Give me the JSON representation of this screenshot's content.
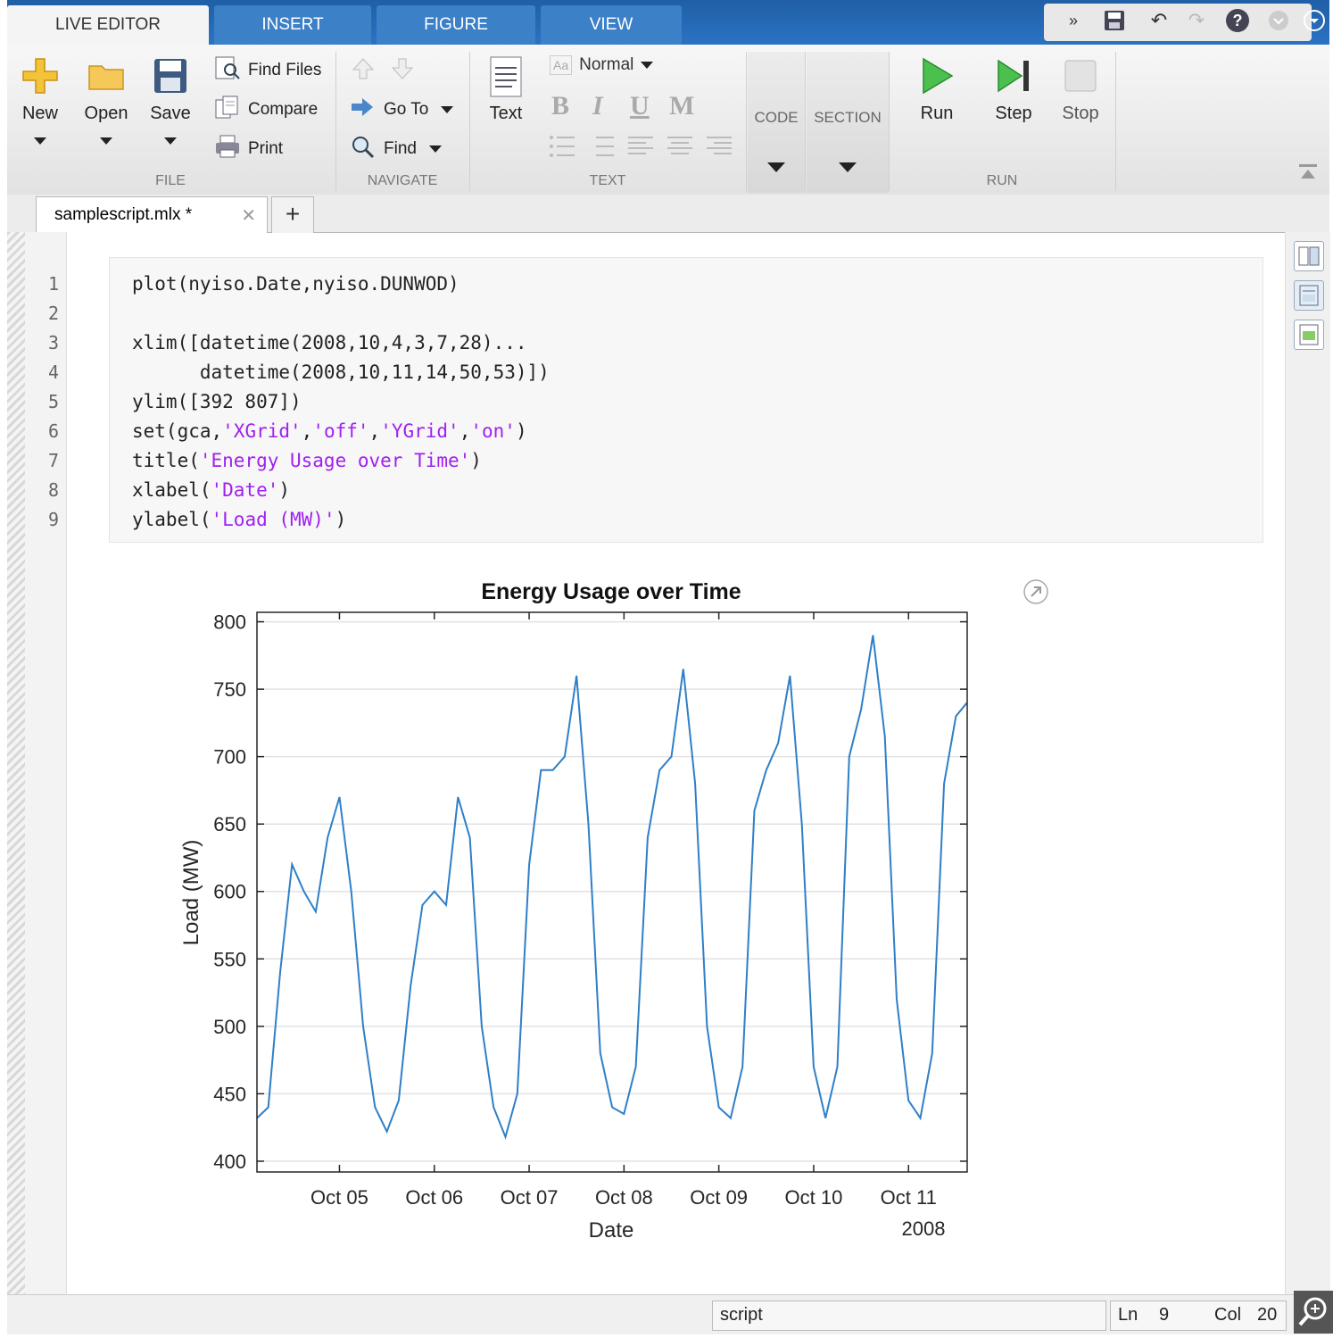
{
  "ribbon_tabs": [
    "LIVE EDITOR",
    "INSERT",
    "FIGURE",
    "VIEW"
  ],
  "file_section": {
    "label": "FILE",
    "new": "New",
    "open": "Open",
    "save": "Save",
    "find_files": "Find Files",
    "compare": "Compare",
    "print": "Print"
  },
  "navigate_section": {
    "label": "NAVIGATE",
    "go_to": "Go To",
    "find": "Find"
  },
  "text_section": {
    "label": "TEXT",
    "text": "Text",
    "style": "Normal",
    "style_icon": "Aa",
    "bold": "B",
    "italic": "I",
    "underline": "U",
    "mono": "M"
  },
  "code_section": {
    "label": "CODE"
  },
  "section_section": {
    "label": "SECTION"
  },
  "run_section": {
    "label": "RUN",
    "run": "Run",
    "step": "Step",
    "stop": "Stop"
  },
  "document_tab": {
    "name": "samplescript.mlx *",
    "add": "+"
  },
  "code_lines": [
    {
      "n": "1",
      "parts": [
        {
          "t": "plot(nyiso.Date,nyiso.DUNWOD)",
          "s": false
        }
      ]
    },
    {
      "n": "2",
      "parts": []
    },
    {
      "n": "3",
      "parts": [
        {
          "t": "xlim([datetime(2008,10,4,3,7,28)...",
          "s": false
        }
      ]
    },
    {
      "n": "4",
      "parts": [
        {
          "t": "      datetime(2008,10,11,14,50,53)])",
          "s": false
        }
      ]
    },
    {
      "n": "5",
      "parts": [
        {
          "t": "ylim([392 807])",
          "s": false
        }
      ]
    },
    {
      "n": "6",
      "parts": [
        {
          "t": "set(gca,",
          "s": false
        },
        {
          "t": "'XGrid'",
          "s": true
        },
        {
          "t": ",",
          "s": false
        },
        {
          "t": "'off'",
          "s": true
        },
        {
          "t": ",",
          "s": false
        },
        {
          "t": "'YGrid'",
          "s": true
        },
        {
          "t": ",",
          "s": false
        },
        {
          "t": "'on'",
          "s": true
        },
        {
          "t": ")",
          "s": false
        }
      ]
    },
    {
      "n": "7",
      "parts": [
        {
          "t": "title(",
          "s": false
        },
        {
          "t": "'Energy Usage over Time'",
          "s": true
        },
        {
          "t": ")",
          "s": false
        }
      ]
    },
    {
      "n": "8",
      "parts": [
        {
          "t": "xlabel(",
          "s": false
        },
        {
          "t": "'Date'",
          "s": true
        },
        {
          "t": ")",
          "s": false
        }
      ]
    },
    {
      "n": "9",
      "parts": [
        {
          "t": "ylabel(",
          "s": false
        },
        {
          "t": "'Load (MW)'",
          "s": true
        },
        {
          "t": ")",
          "s": false
        }
      ]
    }
  ],
  "status": {
    "mode": "script",
    "ln_label": "Ln",
    "ln": "9",
    "col_label": "Col",
    "col": "20"
  },
  "colors": {
    "line": "#2f7fc8",
    "ribbon": "#2b73c2",
    "string": "#a020f0"
  },
  "chart_data": {
    "type": "line",
    "title": "Energy Usage over Time",
    "xlabel": "Date",
    "ylabel": "Load (MW)",
    "x_secondary_label": "2008",
    "x_ticks": [
      "Oct 05",
      "Oct 06",
      "Oct 07",
      "Oct 08",
      "Oct 09",
      "Oct 10",
      "Oct 11"
    ],
    "ylim": [
      392,
      807
    ],
    "y_ticks": [
      400,
      450,
      500,
      550,
      600,
      650,
      700,
      750,
      800
    ],
    "xlim": [
      "2008-10-04 03:07:28",
      "2008-10-11 14:50:53"
    ],
    "grid": {
      "x": false,
      "y": true
    },
    "series": [
      {
        "x": [
          "2008-10-04 03:00",
          "2008-10-04 06:00",
          "2008-10-04 09:00",
          "2008-10-04 12:00",
          "2008-10-04 15:00",
          "2008-10-04 18:00",
          "2008-10-04 21:00",
          "2008-10-05 00:00",
          "2008-10-05 03:00",
          "2008-10-05 06:00",
          "2008-10-05 09:00",
          "2008-10-05 12:00",
          "2008-10-05 15:00",
          "2008-10-05 18:00",
          "2008-10-05 21:00",
          "2008-10-06 00:00",
          "2008-10-06 03:00",
          "2008-10-06 06:00",
          "2008-10-06 09:00",
          "2008-10-06 12:00",
          "2008-10-06 15:00",
          "2008-10-06 18:00",
          "2008-10-06 21:00",
          "2008-10-07 00:00",
          "2008-10-07 03:00",
          "2008-10-07 06:00",
          "2008-10-07 09:00",
          "2008-10-07 12:00",
          "2008-10-07 15:00",
          "2008-10-07 18:00",
          "2008-10-07 21:00",
          "2008-10-08 00:00",
          "2008-10-08 03:00",
          "2008-10-08 06:00",
          "2008-10-08 09:00",
          "2008-10-08 12:00",
          "2008-10-08 15:00",
          "2008-10-08 18:00",
          "2008-10-08 21:00",
          "2008-10-09 00:00",
          "2008-10-09 03:00",
          "2008-10-09 06:00",
          "2008-10-09 09:00",
          "2008-10-09 12:00",
          "2008-10-09 15:00",
          "2008-10-09 18:00",
          "2008-10-09 21:00",
          "2008-10-10 00:00",
          "2008-10-10 03:00",
          "2008-10-10 06:00",
          "2008-10-10 09:00",
          "2008-10-10 12:00",
          "2008-10-10 15:00",
          "2008-10-10 18:00",
          "2008-10-10 21:00",
          "2008-10-11 00:00",
          "2008-10-11 03:00",
          "2008-10-11 06:00",
          "2008-10-11 09:00",
          "2008-10-11 12:00",
          "2008-10-11 14:50"
        ],
        "y": [
          432,
          440,
          540,
          620,
          600,
          585,
          640,
          670,
          600,
          500,
          440,
          422,
          445,
          530,
          590,
          600,
          590,
          670,
          640,
          500,
          440,
          418,
          450,
          620,
          690,
          690,
          700,
          760,
          650,
          480,
          440,
          435,
          470,
          640,
          690,
          700,
          765,
          680,
          500,
          440,
          432,
          470,
          660,
          690,
          710,
          760,
          650,
          470,
          432,
          470,
          700,
          735,
          790,
          715,
          520,
          445,
          432,
          480,
          680,
          730,
          740
        ],
        "y_tail_note": null
      }
    ]
  }
}
